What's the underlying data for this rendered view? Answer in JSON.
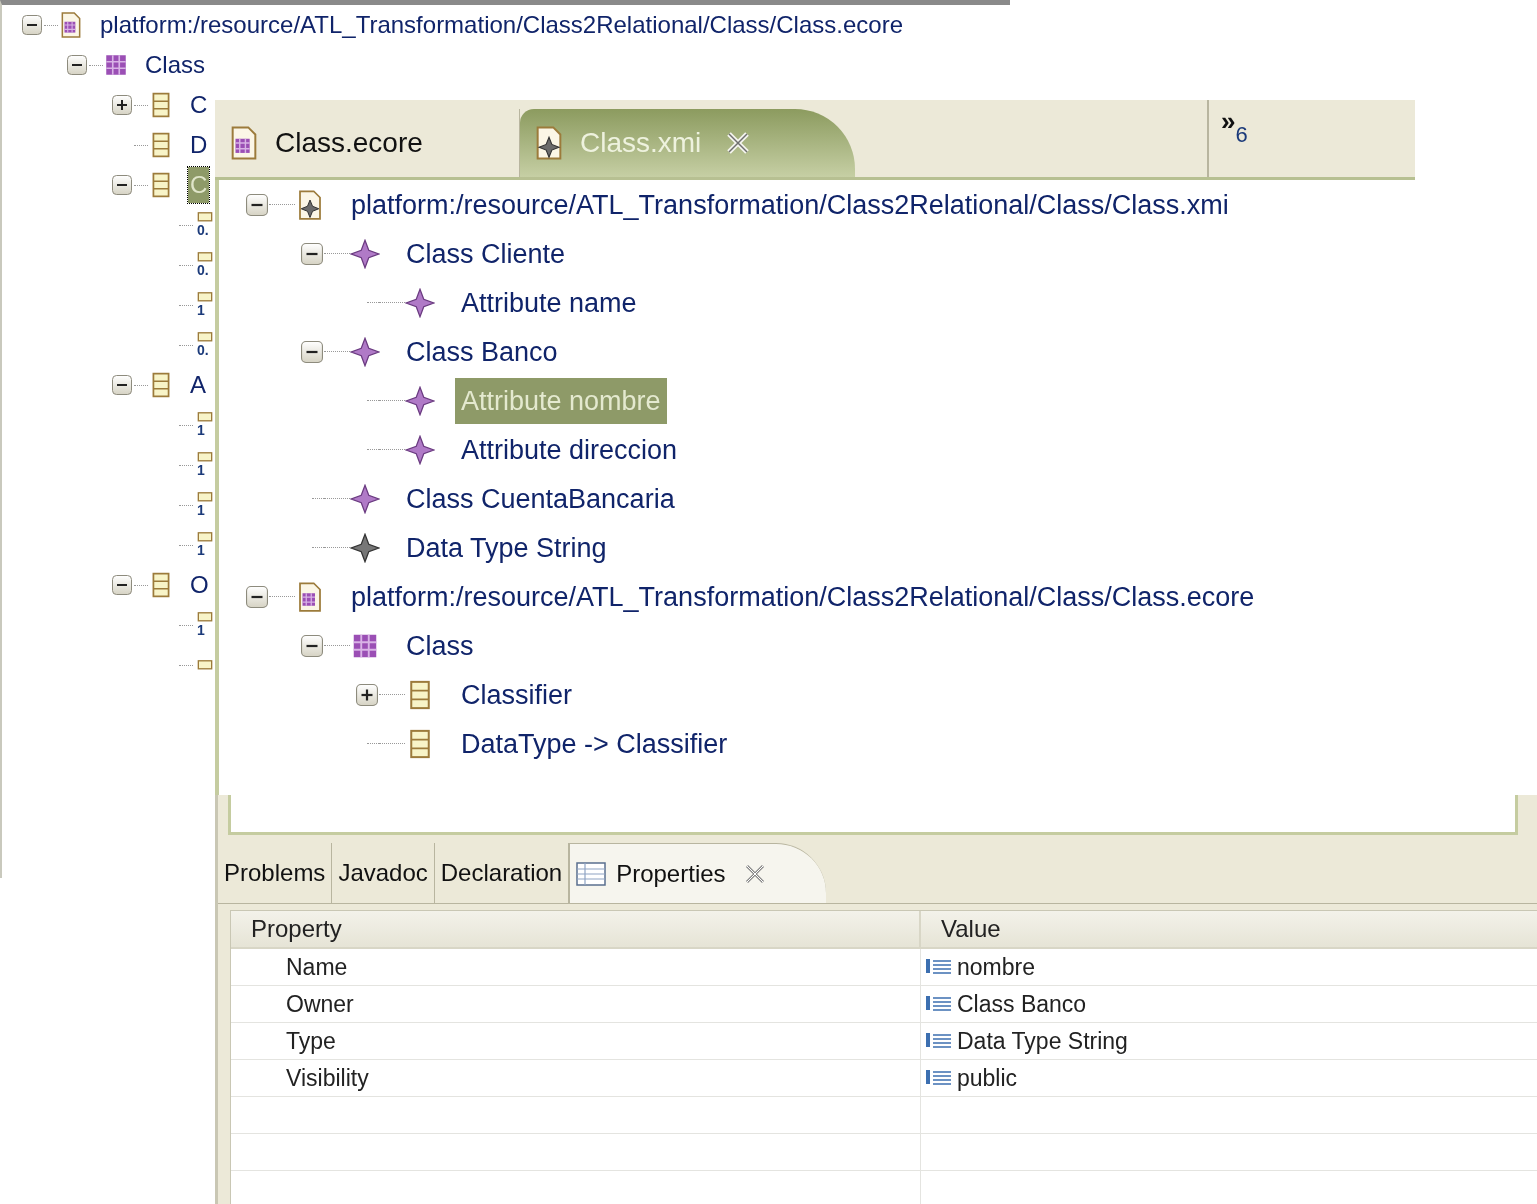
{
  "background_tree": {
    "items": [
      {
        "kind": "ecore_resource",
        "label": "platform:/resource/ATL_Transformation/Class2Relational/Class/Class.ecore",
        "expanded": true,
        "selected": false,
        "children": [
          {
            "kind": "package",
            "label": "Class",
            "expanded": true,
            "selected": false,
            "children": [
              {
                "kind": "eclass",
                "label": "C",
                "expanded": false,
                "selected": false
              },
              {
                "kind": "eclass",
                "label": "D",
                "selected": false
              },
              {
                "kind": "eclass",
                "label": "C",
                "expanded": true,
                "selected": true,
                "children": [
                  {
                    "kind": "feature",
                    "label": "0."
                  },
                  {
                    "kind": "feature",
                    "label": "0."
                  },
                  {
                    "kind": "feature",
                    "label": "1"
                  },
                  {
                    "kind": "feature",
                    "label": "0."
                  }
                ]
              },
              {
                "kind": "eclass",
                "label": "A",
                "expanded": true,
                "selected": false,
                "children": [
                  {
                    "kind": "feature",
                    "label": "1"
                  },
                  {
                    "kind": "feature",
                    "label": "1"
                  },
                  {
                    "kind": "feature",
                    "label": "1"
                  },
                  {
                    "kind": "feature",
                    "label": "1"
                  }
                ]
              },
              {
                "kind": "eclass",
                "label": "O",
                "expanded": true,
                "selected": false,
                "children": [
                  {
                    "kind": "feature",
                    "label": "1"
                  },
                  {
                    "kind": "feature"
                  }
                ]
              }
            ]
          }
        ]
      }
    ]
  },
  "editor": {
    "tabs": [
      {
        "kind": "ecore",
        "label": "Class.ecore",
        "selected": false
      },
      {
        "kind": "xmi",
        "label": "Class.xmi",
        "selected": true
      }
    ],
    "overflow": {
      "symbol": "»",
      "count": "6"
    },
    "tree": [
      {
        "kind": "xmi_resource",
        "label": "platform:/resource/ATL_Transformation/Class2Relational/Class/Class.xmi",
        "expanded": true,
        "selected": false,
        "children": [
          {
            "kind": "object",
            "label": "Class Cliente",
            "expanded": true,
            "selected": false,
            "children": [
              {
                "kind": "object",
                "label": "Attribute name",
                "selected": false
              }
            ]
          },
          {
            "kind": "object",
            "label": "Class Banco",
            "expanded": true,
            "selected": false,
            "children": [
              {
                "kind": "object",
                "label": "Attribute nombre",
                "selected": true
              },
              {
                "kind": "object",
                "label": "Attribute direccion",
                "selected": false
              }
            ]
          },
          {
            "kind": "object",
            "label": "Class CuentaBancaria",
            "selected": false
          },
          {
            "kind": "datatype",
            "label": "Data Type String",
            "selected": false
          }
        ]
      },
      {
        "kind": "ecore_resource",
        "label": "platform:/resource/ATL_Transformation/Class2Relational/Class/Class.ecore",
        "expanded": true,
        "selected": false,
        "children": [
          {
            "kind": "package",
            "label": "Class",
            "expanded": true,
            "selected": false,
            "children": [
              {
                "kind": "eclass",
                "label": "Classifier",
                "expanded": false,
                "selected": false
              },
              {
                "kind": "eclass",
                "label": "DataType -> Classifier",
                "selected": false
              }
            ]
          }
        ]
      }
    ]
  },
  "views": {
    "tabs": [
      {
        "label": "Problems",
        "selected": false
      },
      {
        "label": "Javadoc",
        "selected": false
      },
      {
        "label": "Declaration",
        "selected": false
      },
      {
        "label": "Properties",
        "selected": true
      }
    ],
    "properties": {
      "columns": [
        "Property",
        "Value"
      ],
      "rows": [
        {
          "property": "Name",
          "value": "nombre"
        },
        {
          "property": "Owner",
          "value": "Class Banco"
        },
        {
          "property": "Type",
          "value": "Data Type String"
        },
        {
          "property": "Visibility",
          "value": "public"
        }
      ]
    }
  }
}
